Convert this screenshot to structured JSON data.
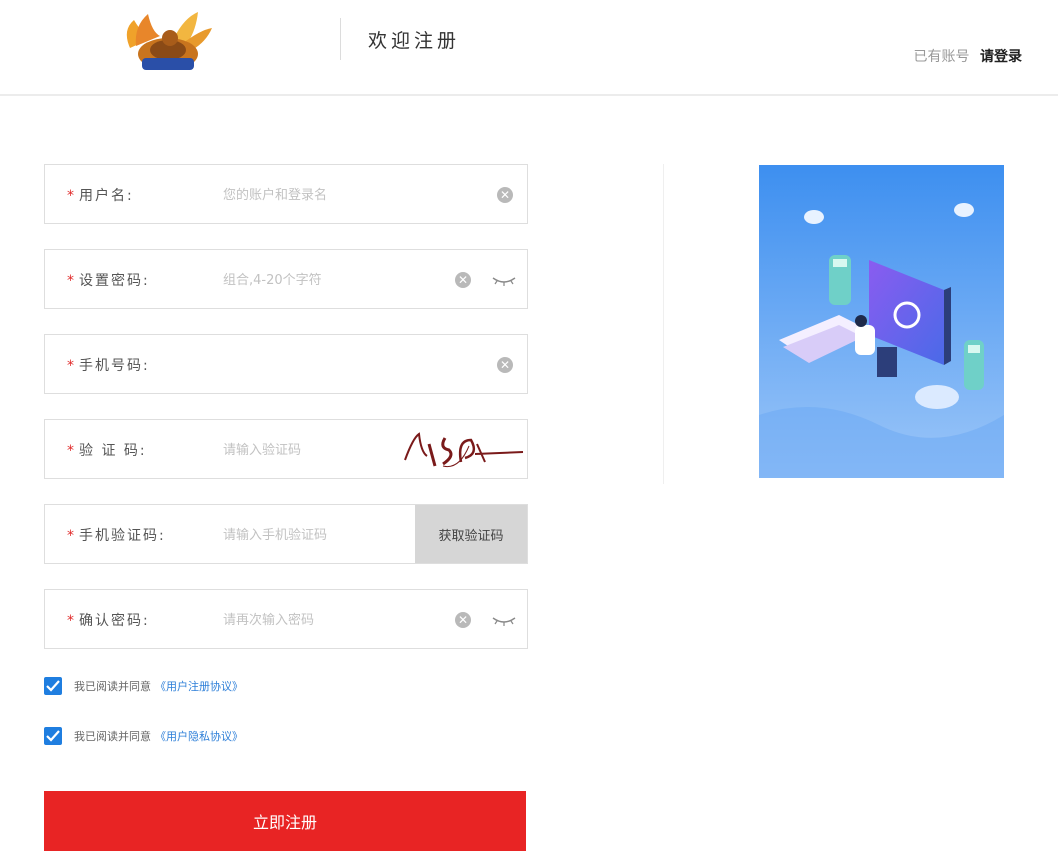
{
  "header": {
    "title": "欢迎注册",
    "login_hint": "已有账号",
    "login_link": "请登录"
  },
  "form": {
    "username": {
      "label": "用户名:",
      "placeholder": "您的账户和登录名"
    },
    "password": {
      "label": "设置密码:",
      "placeholder": "组合,4-20个字符"
    },
    "phone": {
      "label": "手机号码:",
      "placeholder": ""
    },
    "captcha": {
      "label": "验  证  码:",
      "placeholder": "请输入验证码"
    },
    "sms_code": {
      "label": "手机验证码:",
      "placeholder": "请输入手机验证码",
      "button": "获取验证码"
    },
    "confirm_password": {
      "label": "确认密码:",
      "placeholder": "请再次输入密码"
    },
    "required_mark": "*",
    "clear_glyph": "✕"
  },
  "agreements": [
    {
      "prefix": "我已阅读并同意",
      "link": "《用户注册协议》",
      "checked": true
    },
    {
      "prefix": "我已阅读并同意",
      "link": "《用户隐私协议》",
      "checked": true
    }
  ],
  "submit_label": "立即注册",
  "colors": {
    "accent_red": "#e82424",
    "checkbox_blue": "#1f7ee0",
    "link_blue": "#2e7fd8"
  }
}
